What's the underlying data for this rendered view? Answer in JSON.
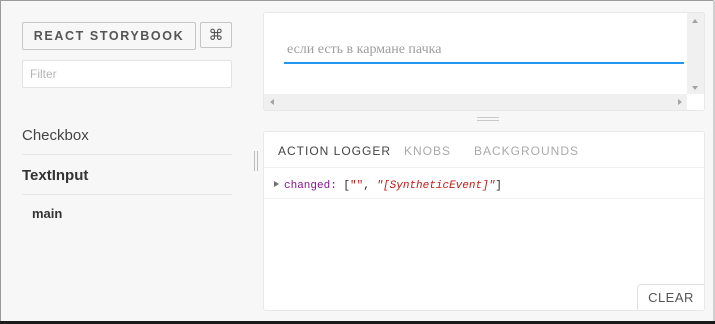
{
  "sidebar": {
    "brand_label": "REACT STORYBOOK",
    "shortcut_label": "⌘",
    "filter_placeholder": "Filter",
    "kinds": [
      {
        "label": "Checkbox",
        "selected": false
      },
      {
        "label": "TextInput",
        "selected": true
      }
    ],
    "stories": [
      "main"
    ]
  },
  "preview": {
    "input_placeholder": "если есть в кармане пачка",
    "input_value": "",
    "accent_color": "#2196f3"
  },
  "addons": {
    "tabs": [
      "ACTION LOGGER",
      "KNOBS",
      "BACKGROUNDS"
    ],
    "active_tab": "ACTION LOGGER",
    "log": {
      "name": "changed:",
      "open_bracket": "[",
      "arg1": "\"\"",
      "comma": ",",
      "arg2": "\"[SyntheticEvent]\"",
      "close_bracket": "]"
    },
    "clear_label": "CLEAR"
  }
}
